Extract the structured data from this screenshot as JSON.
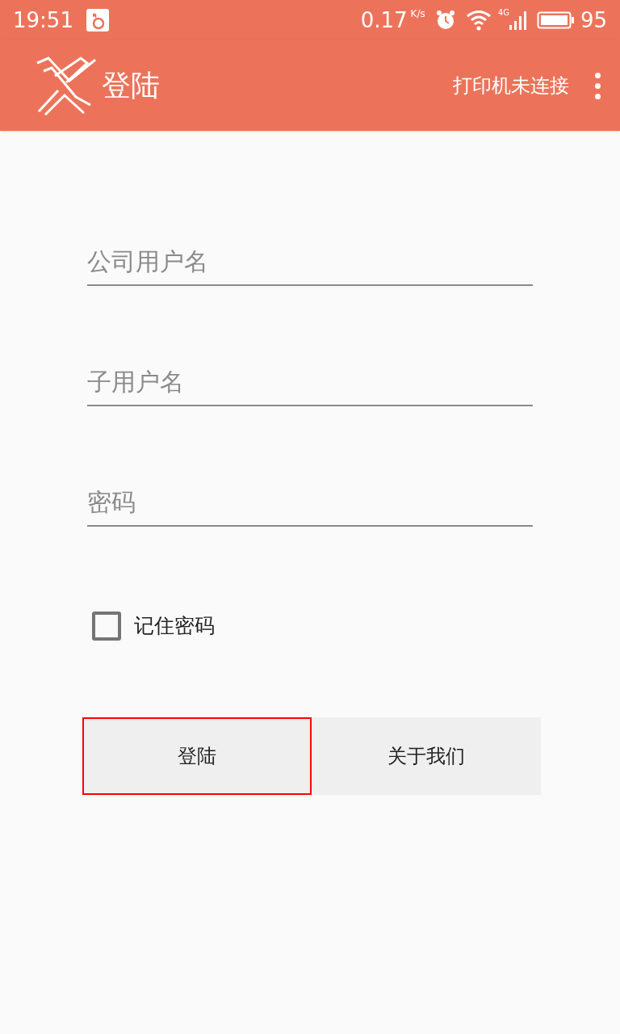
{
  "status_bar": {
    "time": "19:51",
    "speed": "0.17",
    "speed_unit": "K/s",
    "network": "4G",
    "battery": "95"
  },
  "app_bar": {
    "title": "登陆",
    "printer_status": "打印机未连接"
  },
  "fields": [
    {
      "placeholder": "公司用户名"
    },
    {
      "placeholder": "子用户名"
    },
    {
      "placeholder": "密码"
    }
  ],
  "remember": {
    "label": "记住密码",
    "checked": false
  },
  "buttons": [
    {
      "label": "登陆",
      "focused": true
    },
    {
      "label": "关于我们",
      "focused": false
    }
  ]
}
